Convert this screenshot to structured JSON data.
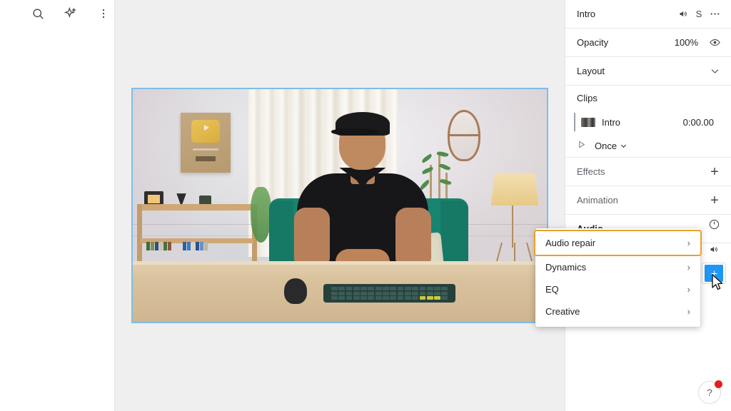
{
  "toolbar": {
    "icons": [
      {
        "name": "search-icon",
        "label": "Search"
      },
      {
        "name": "sparkle-icon",
        "label": "Magic tools"
      },
      {
        "name": "more-vertical-icon",
        "label": "More options"
      }
    ]
  },
  "properties_panel": {
    "header": {
      "title": "Intro",
      "mute_icon": "speaker-icon",
      "solo_label": "S",
      "more_icon": "more-horizontal-icon"
    },
    "opacity": {
      "label": "Opacity",
      "value": "100%",
      "visibility_icon": "eye-icon"
    },
    "layout": {
      "label": "Layout",
      "chevron_icon": "chevron-down-icon"
    },
    "clips": {
      "label": "Clips",
      "items": [
        {
          "name": "Intro",
          "timecode": "0:00.00",
          "thumbnail": "clip-thumbnail"
        }
      ],
      "loop": {
        "play_icon": "play-icon",
        "mode": "Once",
        "chevron_icon": "chevron-down-icon"
      }
    },
    "effects": {
      "label": "Effects",
      "add_icon": "plus-icon"
    },
    "animation": {
      "label": "Animation",
      "add_icon": "plus-icon"
    },
    "audio": {
      "label": "Audio",
      "timing_icon": "clock-icon",
      "volume_icon": "speaker-icon",
      "add_effect_icon": "add-audio-effect-icon"
    }
  },
  "context_menu": {
    "items": [
      {
        "label": "Audio repair",
        "selected": true,
        "chevron": "›"
      },
      {
        "label": "Dynamics",
        "selected": false,
        "chevron": "›"
      },
      {
        "label": "EQ",
        "selected": false,
        "chevron": "›"
      },
      {
        "label": "Creative",
        "selected": false,
        "chevron": "›"
      }
    ]
  },
  "help": {
    "label": "?",
    "has_notification": true
  },
  "colors": {
    "accent_highlight": "#eaa02b",
    "selection_border": "#7fbde8",
    "primary_blue": "#2196f3",
    "notification_red": "#ea1c1c",
    "canvas_bg": "#efefef"
  }
}
